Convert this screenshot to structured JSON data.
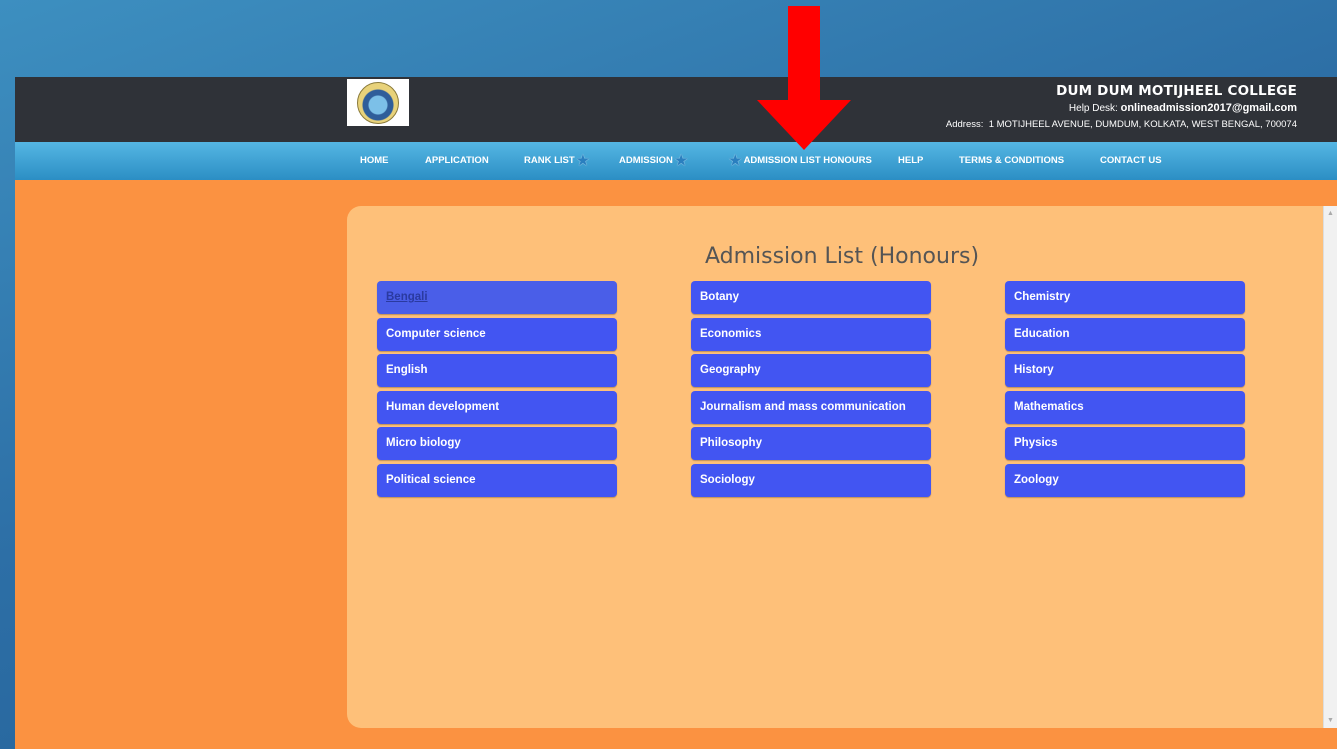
{
  "header": {
    "college_name": "DUM DUM MOTIJHEEL COLLEGE",
    "help_label": "Help Desk:",
    "help_email": "onlineadmission2017@gmail.com",
    "address_label": "Address:",
    "address": "1 MOTIJHEEL AVENUE, DUMDUM, KOLKATA, WEST BENGAL, 700074"
  },
  "nav": {
    "items": [
      {
        "label": "HOME"
      },
      {
        "label": "APPLICATION"
      },
      {
        "label": "RANK LIST"
      },
      {
        "label": "ADMISSION"
      },
      {
        "label": "ADMISSION LIST HONOURS"
      },
      {
        "label": "HELP"
      },
      {
        "label": "TERMS & CONDITIONS"
      },
      {
        "label": "CONTACT US"
      }
    ]
  },
  "page": {
    "title": "Admission List (Honours)"
  },
  "subjects": [
    "Bengali",
    "Botany",
    "Chemistry",
    "Computer science",
    "Economics",
    "Education",
    "English",
    "Geography",
    "History",
    "Human development",
    "Journalism and mass communication",
    "Mathematics",
    "Micro biology",
    "Philosophy",
    "Physics",
    "Political science",
    "Sociology",
    "Zoology"
  ],
  "colors": {
    "annotation_arrow": "#ff0000",
    "subject_button": "#4255f2",
    "panel": "#fec079",
    "page_background": "#fb9241"
  }
}
